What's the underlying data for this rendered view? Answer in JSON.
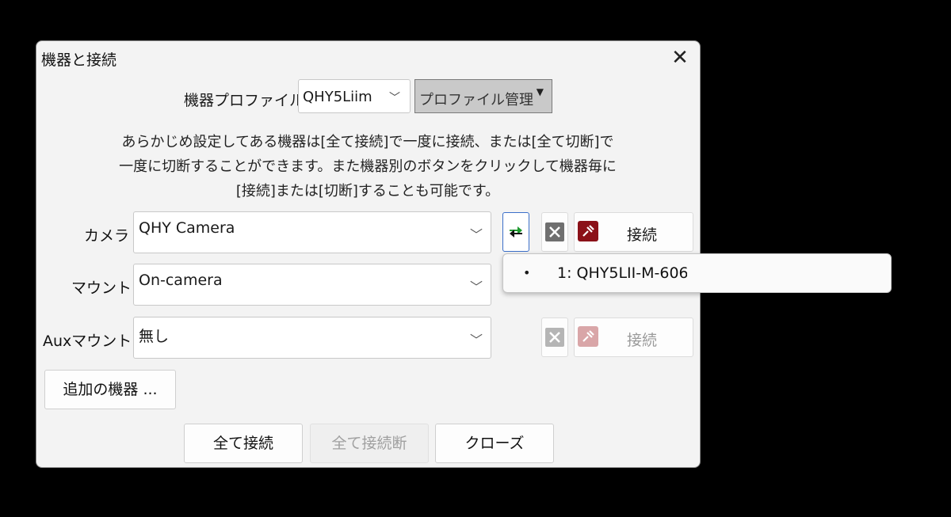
{
  "dialog": {
    "title": "機器と接続",
    "close_icon": "close-icon"
  },
  "profile": {
    "label": "機器プロファイル",
    "selected": "QHY5Liim",
    "manage_label": "プロファイル管理"
  },
  "description": {
    "line1": "あらかじめ設定してある機器は[全て接続]で一度に接続、または[全て切断]で",
    "line2": "一度に切断することができます。また機器別のボタンをクリックして機器毎に",
    "line3": "[接続]または[切断]することも可能です。"
  },
  "rows": [
    {
      "label": "カメラ",
      "value": "QHY Camera",
      "connect_label": "接続"
    },
    {
      "label": "マウント",
      "value": "On-camera",
      "connect_label": ""
    },
    {
      "label": "Auxマウント",
      "value": "無し",
      "connect_label": "接続"
    }
  ],
  "icons": {
    "refresh": "refresh-arrows-icon",
    "settings": "wrench-screwdriver-icon",
    "connect": "plug-icon",
    "dropdown": "chevron-down-icon"
  },
  "popup": {
    "bullet": "•",
    "item": "1: QHY5LII-M-606"
  },
  "buttons": {
    "more_devices": "追加の機器 ...",
    "connect_all": "全て接続",
    "disconnect_all": "全て接続断",
    "close": "クローズ"
  },
  "colors": {
    "dialog_bg": "#f3f3f3",
    "connect_icon": "#8b1118",
    "focus_border": "#3b6fc9",
    "refresh_green": "#1e9a2e"
  }
}
